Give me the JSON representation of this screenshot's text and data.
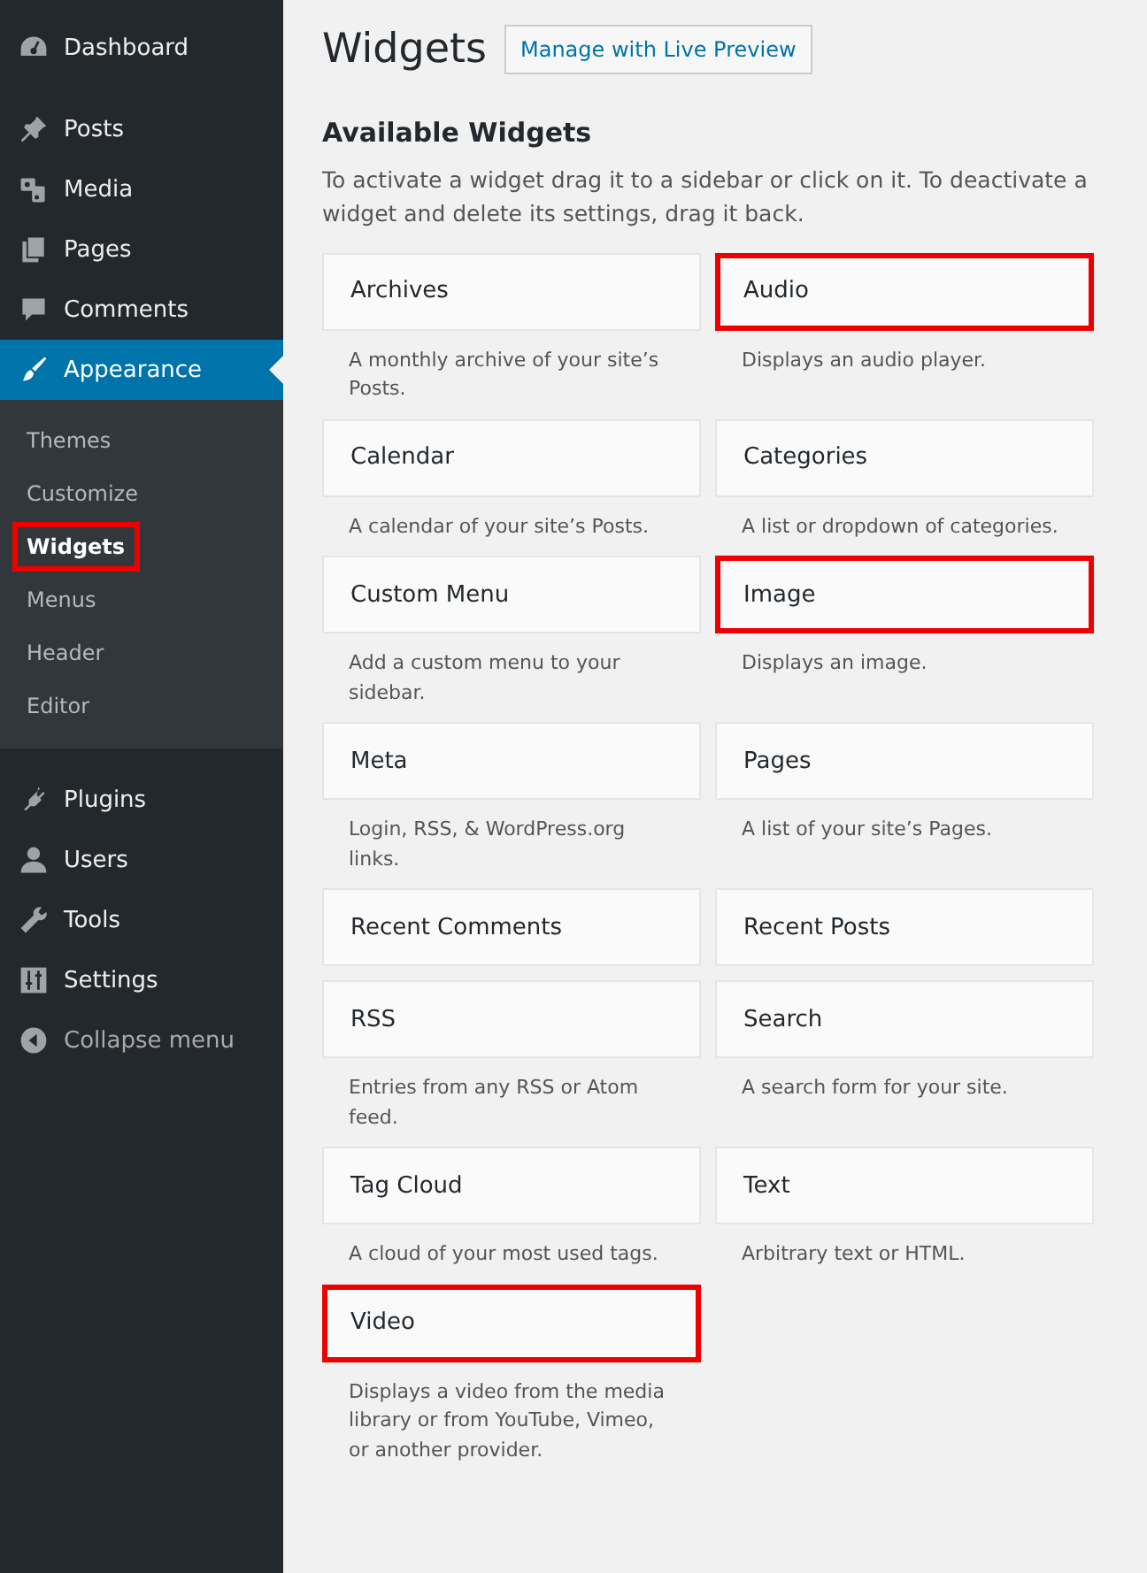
{
  "sidebar": {
    "items": [
      {
        "label": "Dashboard",
        "selected": false
      },
      {
        "label": "Posts",
        "selected": false
      },
      {
        "label": "Media",
        "selected": false
      },
      {
        "label": "Pages",
        "selected": false
      },
      {
        "label": "Comments",
        "selected": false
      },
      {
        "label": "Appearance",
        "selected": true,
        "children": [
          {
            "label": "Themes",
            "selected": false,
            "highlighted": false
          },
          {
            "label": "Customize",
            "selected": false,
            "highlighted": false
          },
          {
            "label": "Widgets",
            "selected": true,
            "highlighted": true
          },
          {
            "label": "Menus",
            "selected": false,
            "highlighted": false
          },
          {
            "label": "Header",
            "selected": false,
            "highlighted": false
          },
          {
            "label": "Editor",
            "selected": false,
            "highlighted": false
          }
        ]
      },
      {
        "label": "Plugins",
        "selected": false
      },
      {
        "label": "Users",
        "selected": false
      },
      {
        "label": "Tools",
        "selected": false
      },
      {
        "label": "Settings",
        "selected": false
      },
      {
        "label": "Collapse menu",
        "selected": false
      }
    ]
  },
  "page": {
    "title": "Widgets",
    "action_button": "Manage with Live Preview"
  },
  "available": {
    "heading": "Available Widgets",
    "description": "To activate a widget drag it to a sidebar or click on it. To deactivate a widget and delete its settings, drag it back.",
    "widgets": [
      {
        "name": "Archives",
        "description": "A monthly archive of your site’s Posts.",
        "highlighted": false
      },
      {
        "name": "Audio",
        "description": "Displays an audio player.",
        "highlighted": true
      },
      {
        "name": "Calendar",
        "description": "A calendar of your site’s Posts.",
        "highlighted": false
      },
      {
        "name": "Categories",
        "description": "A list or dropdown of categories.",
        "highlighted": false
      },
      {
        "name": "Custom Menu",
        "description": "Add a custom menu to your sidebar.",
        "highlighted": false
      },
      {
        "name": "Image",
        "description": "Displays an image.",
        "highlighted": true
      },
      {
        "name": "Meta",
        "description": "Login, RSS, & WordPress.org links.",
        "highlighted": false
      },
      {
        "name": "Pages",
        "description": "A list of your site’s Pages.",
        "highlighted": false
      },
      {
        "name": "Recent Comments",
        "highlighted": false
      },
      {
        "name": "Recent Posts",
        "highlighted": false
      },
      {
        "name": "RSS",
        "description": "Entries from any RSS or Atom feed.",
        "highlighted": false
      },
      {
        "name": "Search",
        "description": "A search form for your site.",
        "highlighted": false
      },
      {
        "name": "Tag Cloud",
        "description": "A cloud of your most used tags.",
        "highlighted": false
      },
      {
        "name": "Text",
        "description": "Arbitrary text or HTML.",
        "highlighted": false
      },
      {
        "name": "Video",
        "description": "Displays a video from the media library or from YouTube, Vimeo, or another provider.",
        "highlighted": true
      }
    ]
  }
}
